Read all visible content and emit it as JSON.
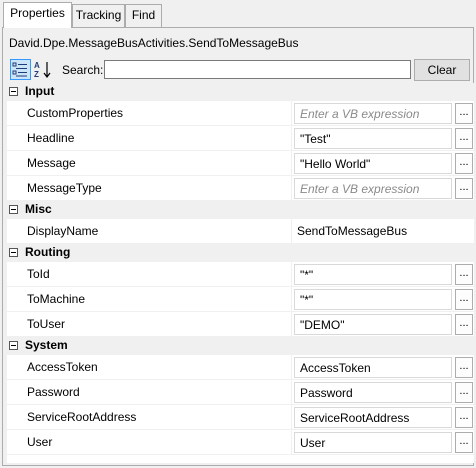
{
  "tabs": [
    {
      "label": "Properties",
      "active": true
    },
    {
      "label": "Tracking",
      "active": false
    },
    {
      "label": "Find",
      "active": false
    }
  ],
  "type_name": "David.Dpe.MessageBusActivities.SendToMessageBus",
  "toolbar": {
    "categorized_icon": "categorized-view-icon",
    "alphabetical_icon": "sort-az-icon",
    "search_label": "Search:",
    "search_value": "",
    "clear_label": "Clear"
  },
  "ellipsis_label": "...",
  "categories": {
    "input": {
      "label": "Input",
      "rows": [
        {
          "name": "CustomProperties",
          "value": "Enter a VB expression",
          "placeholder": true
        },
        {
          "name": "Headline",
          "value": "\"Test\""
        },
        {
          "name": "Message",
          "value": "\"Hello World\""
        },
        {
          "name": "MessageType",
          "value": "Enter a VB expression",
          "placeholder": true
        }
      ]
    },
    "misc": {
      "label": "Misc",
      "rows": [
        {
          "name": "DisplayName",
          "value": "SendToMessageBus"
        }
      ]
    },
    "routing": {
      "label": "Routing",
      "rows": [
        {
          "name": "ToId",
          "value": "\"*\""
        },
        {
          "name": "ToMachine",
          "value": "\"*\""
        },
        {
          "name": "ToUser",
          "value": "\"DEMO\""
        }
      ]
    },
    "system": {
      "label": "System",
      "rows": [
        {
          "name": "AccessToken",
          "value": "AccessToken"
        },
        {
          "name": "Password",
          "value": "Password"
        },
        {
          "name": "ServiceRootAddress",
          "value": "ServiceRootAddress"
        },
        {
          "name": "User",
          "value": "User"
        }
      ]
    }
  },
  "colors": {
    "selected_toolbar_fill": "#cce4f7",
    "selected_toolbar_border": "#3399ff",
    "placeholder_text": "#8a8a8a"
  }
}
